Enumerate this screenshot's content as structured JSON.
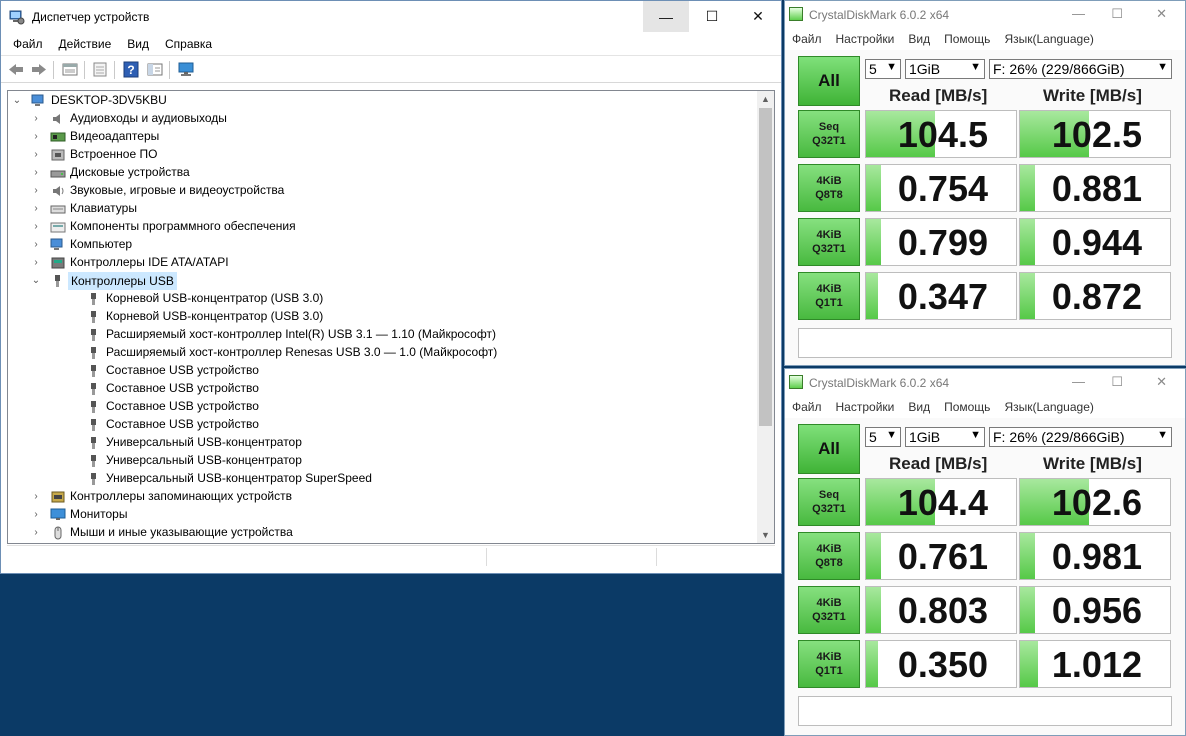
{
  "device_manager": {
    "title": "Диспетчер устройств",
    "menu": [
      "Файл",
      "Действие",
      "Вид",
      "Справка"
    ],
    "caption": {
      "minimize": "—",
      "maximize": "☐",
      "close": "✕"
    },
    "tree": {
      "root": "DESKTOP-3DV5KBU",
      "categories": [
        "Аудиовходы и аудиовыходы",
        "Видеоадаптеры",
        "Встроенное ПО",
        "Дисковые устройства",
        "Звуковые, игровые и видеоустройства",
        "Клавиатуры",
        "Компоненты программного обеспечения",
        "Компьютер",
        "Контроллеры IDE ATA/ATAPI",
        "Контроллеры USB"
      ],
      "usb_children": [
        "Корневой USB-концентратор (USB 3.0)",
        "Корневой USB-концентратор (USB 3.0)",
        "Расширяемый хост-контроллер Intel(R) USB 3.1 — 1.10 (Майкрософт)",
        "Расширяемый хост-контроллер Renesas USB 3.0 — 1.0 (Майкрософт)",
        "Составное USB устройство",
        "Составное USB устройство",
        "Составное USB устройство",
        "Составное USB устройство",
        "Универсальный USB-концентратор",
        "Универсальный USB-концентратор",
        "Универсальный USB-концентратор SuperSpeed"
      ],
      "after": [
        "Контроллеры запоминающих устройств",
        "Мониторы",
        "Мыши и иные указывающие устройства"
      ]
    }
  },
  "cdm": [
    {
      "title": "CrystalDiskMark 6.0.2 x64",
      "menu": [
        "Файл",
        "Настройки",
        "Вид",
        "Помощь",
        "Язык(Language)"
      ],
      "all_label": "All",
      "count": "5",
      "size": "1GiB",
      "drive": "F: 26% (229/866GiB)",
      "read_header": "Read [MB/s]",
      "write_header": "Write [MB/s]",
      "tests": [
        {
          "l1": "Seq",
          "l2": "Q32T1",
          "read": "104.5",
          "write": "102.5",
          "read_fill": 0.46,
          "write_fill": 0.46
        },
        {
          "l1": "4KiB",
          "l2": "Q8T8",
          "read": "0.754",
          "write": "0.881",
          "read_fill": 0.1,
          "write_fill": 0.1
        },
        {
          "l1": "4KiB",
          "l2": "Q32T1",
          "read": "0.799",
          "write": "0.944",
          "read_fill": 0.1,
          "write_fill": 0.1
        },
        {
          "l1": "4KiB",
          "l2": "Q1T1",
          "read": "0.347",
          "write": "0.872",
          "read_fill": 0.08,
          "write_fill": 0.1
        }
      ]
    },
    {
      "title": "CrystalDiskMark 6.0.2 x64",
      "menu": [
        "Файл",
        "Настройки",
        "Вид",
        "Помощь",
        "Язык(Language)"
      ],
      "all_label": "All",
      "count": "5",
      "size": "1GiB",
      "drive": "F: 26% (229/866GiB)",
      "read_header": "Read [MB/s]",
      "write_header": "Write [MB/s]",
      "tests": [
        {
          "l1": "Seq",
          "l2": "Q32T1",
          "read": "104.4",
          "write": "102.6",
          "read_fill": 0.46,
          "write_fill": 0.46
        },
        {
          "l1": "4KiB",
          "l2": "Q8T8",
          "read": "0.761",
          "write": "0.981",
          "read_fill": 0.1,
          "write_fill": 0.1
        },
        {
          "l1": "4KiB",
          "l2": "Q32T1",
          "read": "0.803",
          "write": "0.956",
          "read_fill": 0.1,
          "write_fill": 0.1
        },
        {
          "l1": "4KiB",
          "l2": "Q1T1",
          "read": "0.350",
          "write": "1.012",
          "read_fill": 0.08,
          "write_fill": 0.12
        }
      ]
    }
  ]
}
